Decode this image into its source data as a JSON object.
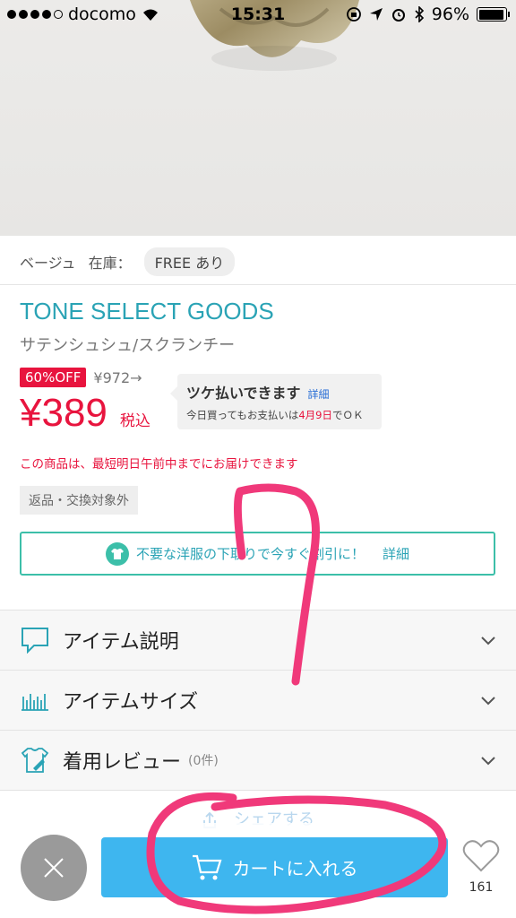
{
  "status_bar": {
    "carrier": "docomo",
    "time": "15:31",
    "battery": "96%"
  },
  "product": {
    "color": "ベージュ",
    "stock_label": "在庫：",
    "size_chip": "FREE あり",
    "brand": "TONE SELECT GOODS",
    "name": "サテンシュシュ/スクランチー",
    "discount_badge": "60%OFF",
    "original_price": "¥972→",
    "price": "¥389",
    "tax_label": "税込",
    "delivery_notice": "この商品は、最短明日午前中までにお届けできます",
    "return_tag": "返品・交換対象外"
  },
  "tsuke": {
    "title": "ツケ払いできます",
    "detail_link": "詳細",
    "line_prefix": "今日買ってもお支払いは",
    "line_date": "4月9日",
    "line_suffix": "でＯＫ"
  },
  "trade_banner": {
    "text": "不要な洋服の下取りで今すぐ割引に！",
    "detail_link": "詳細"
  },
  "accordion": {
    "description": "アイテム説明",
    "size": "アイテムサイズ",
    "review": "着用レビュー",
    "review_count": "(0件)"
  },
  "share": {
    "label": "シェアする"
  },
  "bottom": {
    "cart_label": "カートに入れる",
    "favorite_count": "161"
  },
  "colors": {
    "brand_teal": "#2aa3b5",
    "price_red": "#e8143e",
    "cart_blue": "#3eb6ef",
    "annotation_pink": "#f0397a"
  }
}
